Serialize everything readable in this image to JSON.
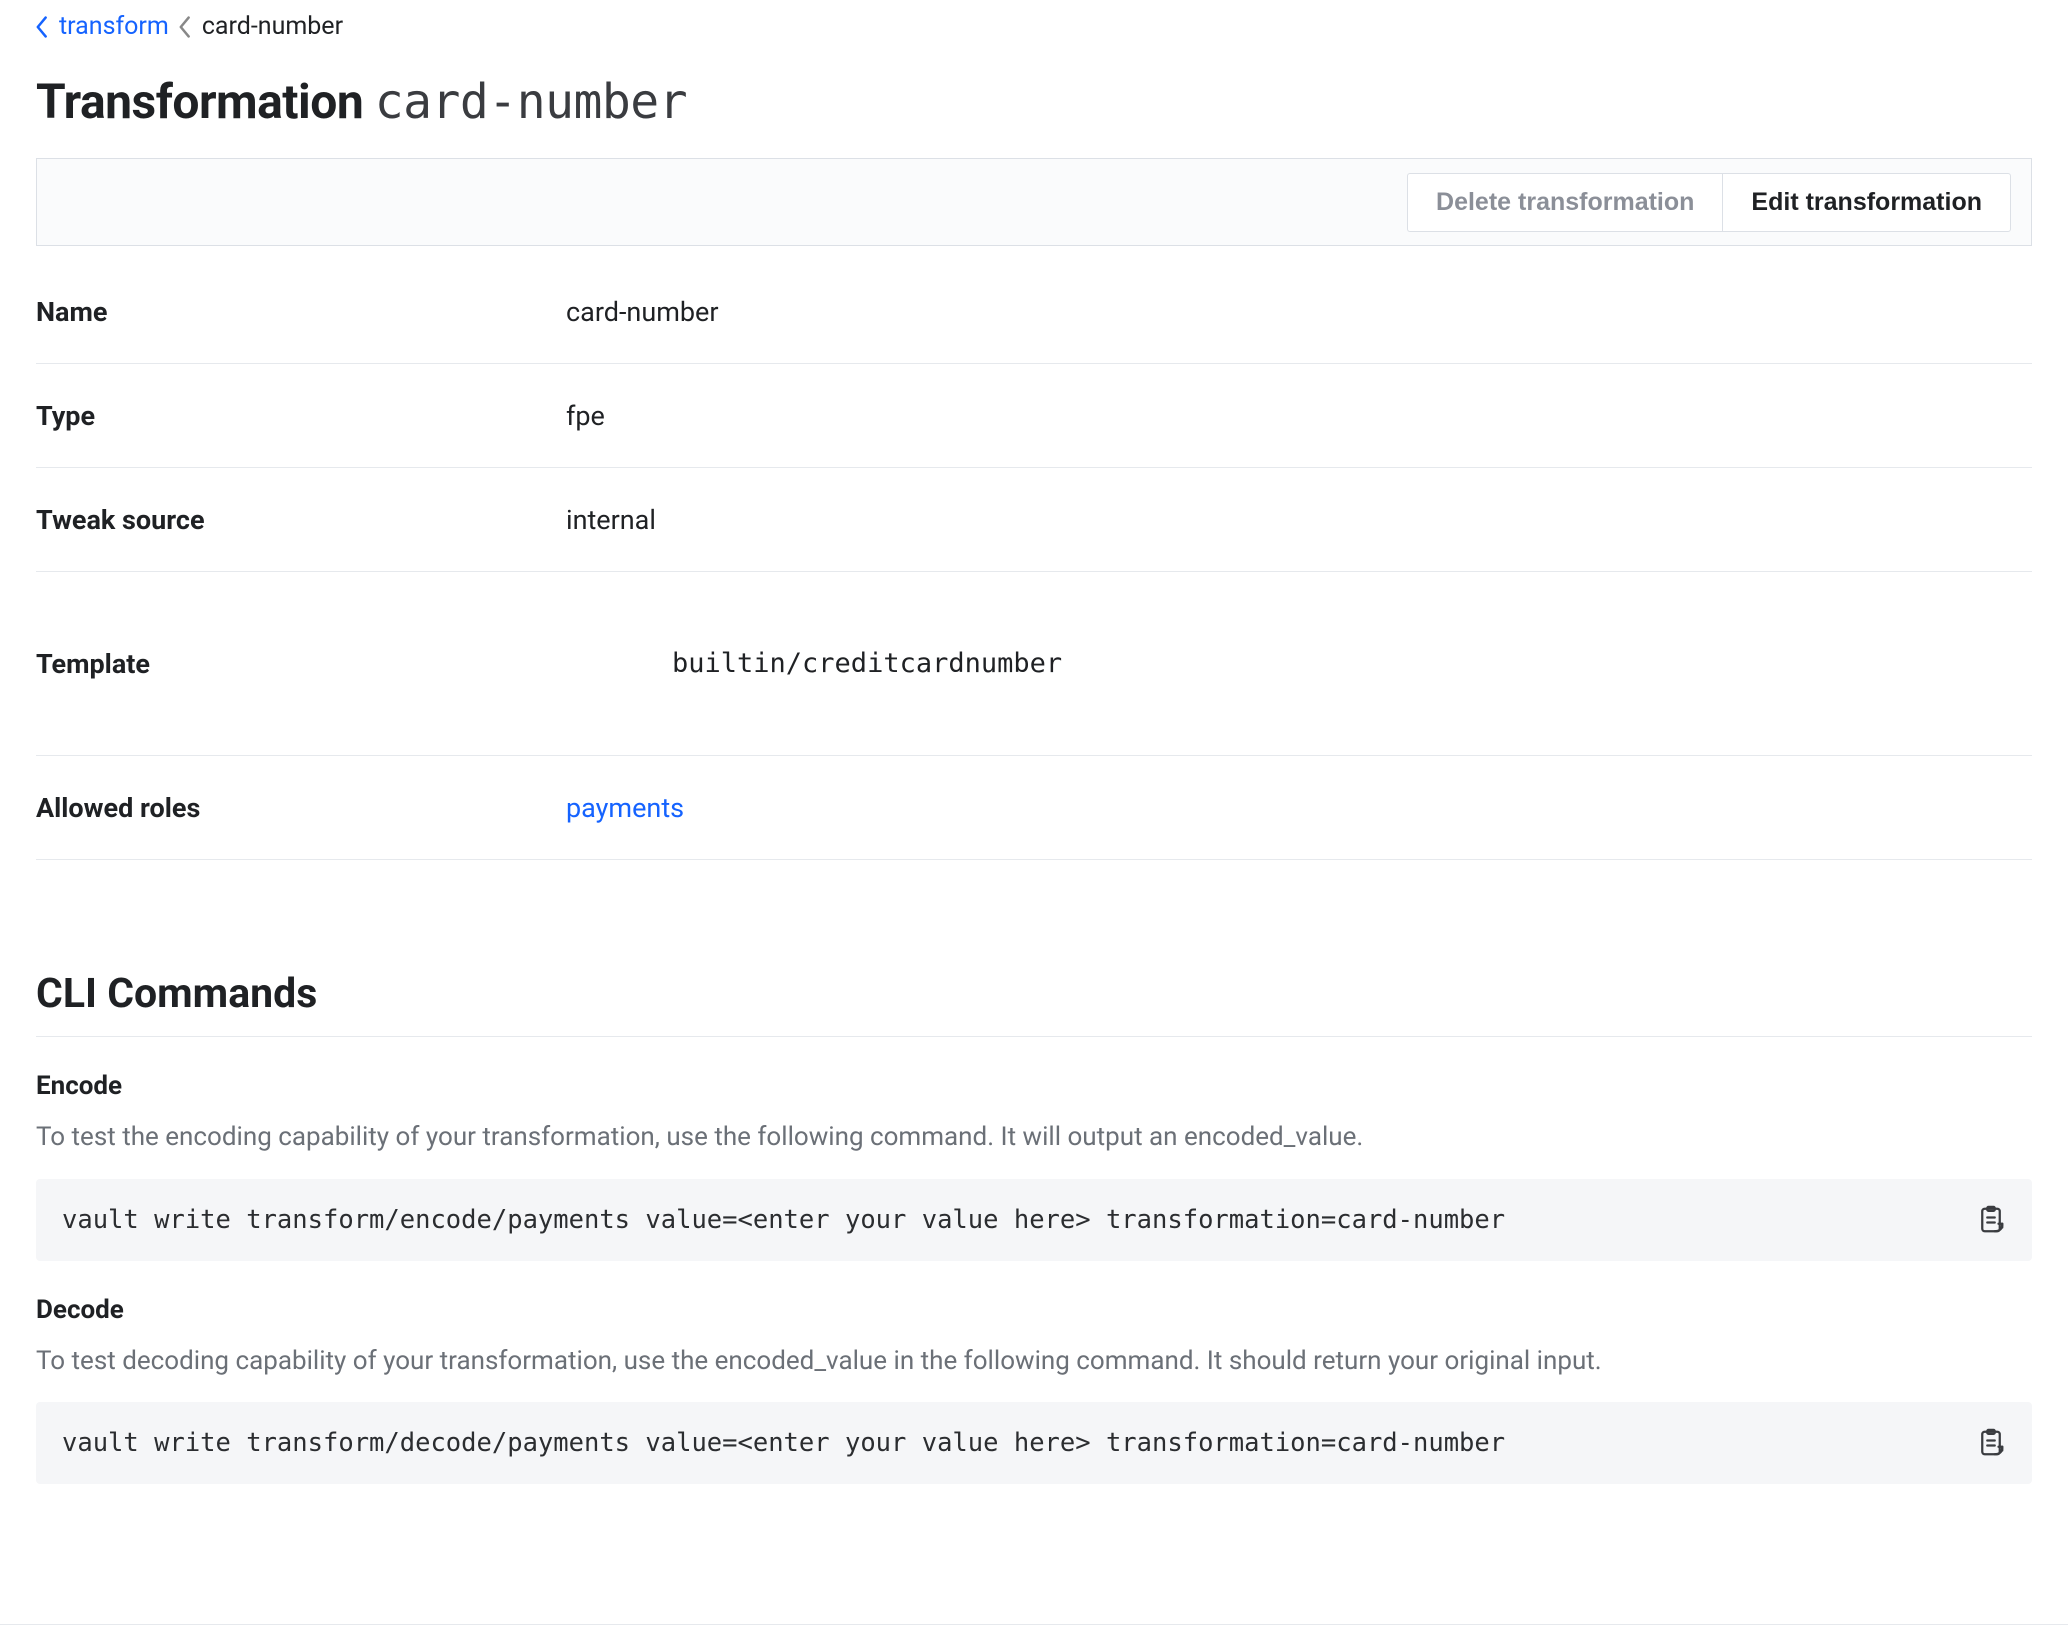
{
  "breadcrumb": {
    "parent": "transform",
    "current": "card-number"
  },
  "title": {
    "prefix": "Transformation",
    "name": "card-number"
  },
  "toolbar": {
    "delete_label": "Delete transformation",
    "edit_label": "Edit transformation"
  },
  "details": {
    "name": {
      "label": "Name",
      "value": "card-number"
    },
    "type": {
      "label": "Type",
      "value": "fpe"
    },
    "tweak_source": {
      "label": "Tweak source",
      "value": "internal"
    },
    "template": {
      "label": "Template",
      "value": "builtin/creditcardnumber"
    },
    "allowed_roles": {
      "label": "Allowed roles",
      "value": "payments"
    }
  },
  "cli": {
    "header": "CLI Commands",
    "encode": {
      "title": "Encode",
      "desc": "To test the encoding capability of your transformation, use the following command. It will output an encoded_value.",
      "cmd": "vault write transform/encode/payments value=<enter your value here> transformation=card-number"
    },
    "decode": {
      "title": "Decode",
      "desc": "To test decoding capability of your transformation, use the encoded_value in the following command. It should return your original input.",
      "cmd": "vault write transform/decode/payments value=<enter your value here> transformation=card-number"
    }
  }
}
